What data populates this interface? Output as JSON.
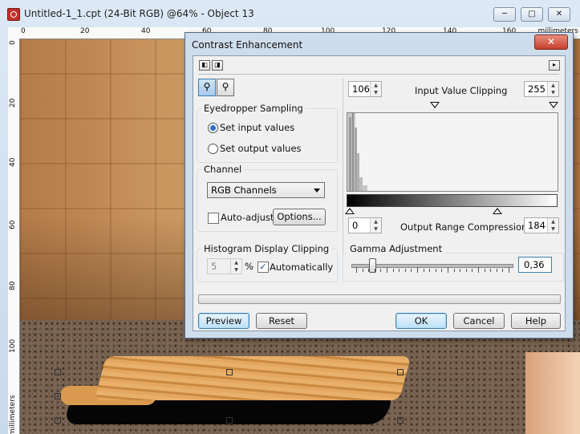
{
  "window": {
    "title": "Untitled-1_1.cpt (24-Bit RGB) @64% - Object 13",
    "minimize": "─",
    "maximize": "□",
    "close": "✕"
  },
  "ruler": {
    "h_ticks": [
      "0",
      "20",
      "40",
      "60",
      "80",
      "100",
      "120",
      "140",
      "160"
    ],
    "v_ticks": [
      "0",
      "20",
      "40",
      "60",
      "80",
      "100"
    ],
    "unit_h": "millimeters",
    "unit_v": "millimeters"
  },
  "dialog": {
    "title": "Contrast Enhancement",
    "close": "✕",
    "nav_left": "◧",
    "nav_mid": "◨",
    "nav_right": "▸",
    "eyedropper": {
      "group_label": "Eyedropper Sampling",
      "option_input": "Set input values",
      "option_output": "Set output values",
      "selected": "input"
    },
    "channel": {
      "group_label": "Channel",
      "selected": "RGB Channels",
      "auto_adjust_label": "Auto-adjust",
      "auto_adjust_checked": false,
      "options_button": "Options..."
    },
    "histogram_clipping": {
      "group_label": "Histogram Display Clipping",
      "value": "5",
      "unit": "%",
      "auto_label": "Automatically",
      "auto_checked": true
    },
    "input_clipping": {
      "label": "Input Value Clipping",
      "low": "106",
      "high": "255"
    },
    "output_range": {
      "label": "Output Range Compression",
      "low": "0",
      "high": "184"
    },
    "gamma": {
      "label": "Gamma Adjustment",
      "value": "0,36",
      "level": 0.05
    },
    "buttons": {
      "preview": "Preview",
      "reset": "Reset",
      "ok": "OK",
      "cancel": "Cancel",
      "help": "Help"
    }
  }
}
